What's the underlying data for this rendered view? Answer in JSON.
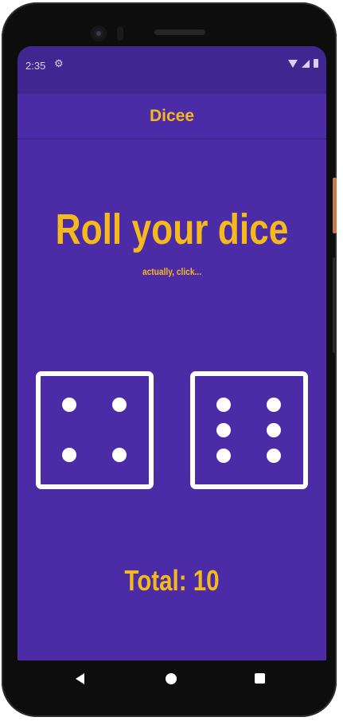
{
  "status_bar": {
    "time": "2:35",
    "icons": [
      "settings-icon",
      "wifi-icon",
      "signal-icon",
      "battery-icon"
    ]
  },
  "app_bar": {
    "title": "Dicee"
  },
  "main": {
    "headline": "Roll your dice",
    "subheadline": "actually, click...",
    "dice": [
      {
        "value": 4,
        "label": "left-die"
      },
      {
        "value": 6,
        "label": "right-die"
      }
    ],
    "total": "Total: 10"
  },
  "nav": {
    "icons": [
      "back-icon",
      "home-icon",
      "recents-icon"
    ]
  },
  "colors": {
    "background": "#4c2ca6",
    "status_bar": "#3f2690",
    "accent": "#f6b91b",
    "die": "#ffffff"
  }
}
